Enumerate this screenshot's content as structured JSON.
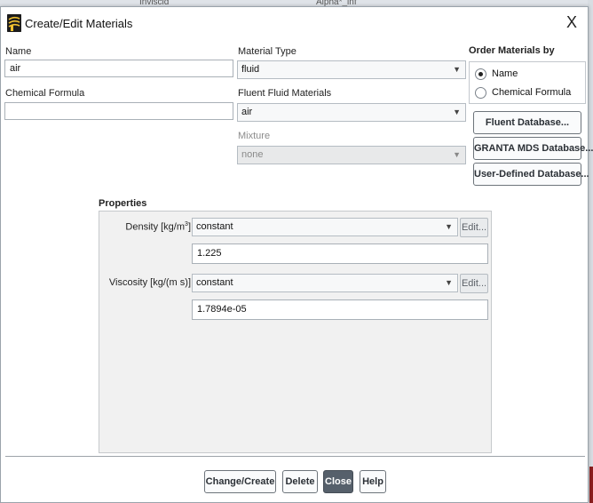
{
  "background": {
    "left_text": "Inviscid",
    "right_text": "Alpha*_inf"
  },
  "window": {
    "title": "Create/Edit Materials",
    "close_glyph": "X"
  },
  "name": {
    "label": "Name",
    "value": "air"
  },
  "chemical_formula": {
    "label": "Chemical Formula",
    "value": ""
  },
  "material_type": {
    "label": "Material Type",
    "value": "fluid"
  },
  "fluent_fluid_materials": {
    "label": "Fluent Fluid Materials",
    "value": "air"
  },
  "mixture": {
    "label": "Mixture",
    "value": "none"
  },
  "order_by": {
    "label": "Order Materials by",
    "options": [
      {
        "label": "Name",
        "selected": true
      },
      {
        "label": "Chemical Formula",
        "selected": false
      }
    ]
  },
  "database_buttons": {
    "fluent": "Fluent Database...",
    "granta": "GRANTA MDS Database...",
    "user_defined": "User-Defined Database..."
  },
  "properties": {
    "title": "Properties",
    "density": {
      "label": "Density [kg/m",
      "unit_sup": "3",
      "label_end": "]",
      "method": "constant",
      "value": "1.225",
      "edit_label": "Edit..."
    },
    "viscosity": {
      "label": "Viscosity [kg/(m s)]",
      "method": "constant",
      "value": "1.7894e-05",
      "edit_label": "Edit..."
    }
  },
  "footer_buttons": {
    "change_create": "Change/Create",
    "delete": "Delete",
    "close": "Close",
    "help": "Help"
  },
  "colors": {
    "accent_dark_button": "#56606b",
    "panel_background": "#f1f1f1"
  },
  "icons": {
    "app": "fluent-app-icon",
    "dropdown": "chevron-down-icon"
  }
}
